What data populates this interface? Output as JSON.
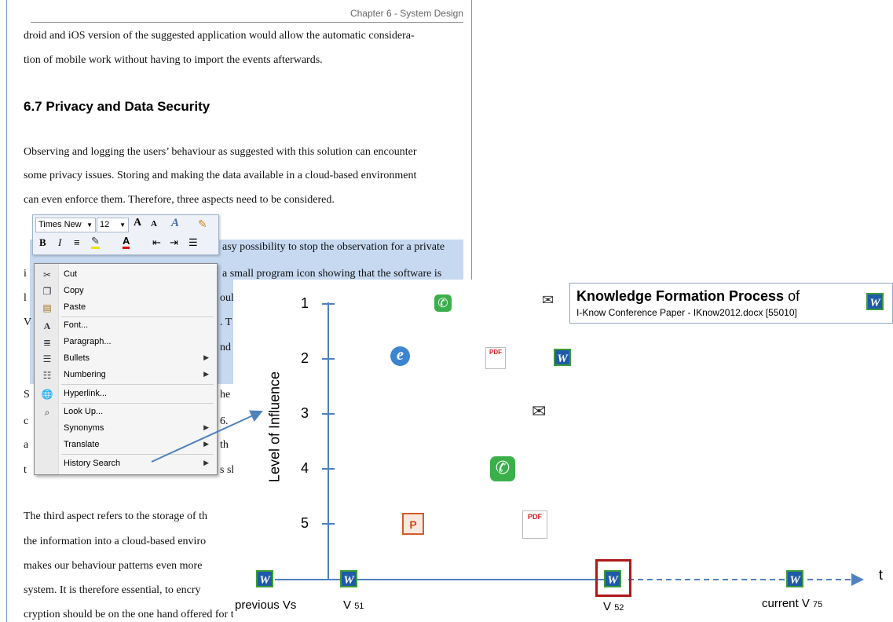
{
  "document": {
    "header": "Chapter 6 - System Design",
    "lines_top": [
      "droid and iOS version of the suggested application would allow the automatic considera-",
      "tion of mobile work without having to import the events afterwards."
    ],
    "heading": "6.7  Privacy and Data Security",
    "para1": [
      "Observing and logging the users’ behaviour as suggested with this solution can encounter",
      "some privacy issues. Storing and making the data available in a cloud-based environment",
      "can even enforce them. Therefore, three aspects need to be considered."
    ],
    "frag_easy": "asy possibility to stop the observation for a private",
    "frag_small": "a small program icon showing that the software is",
    "frag_oul": "oul",
    "frag_T": ". T",
    "frag_nd": "nd",
    "frag_he": "he a",
    "frag_6": "6.",
    "frag_th": "th",
    "frag_s": "s sl",
    "frag_S": "S",
    "frag_c": "c",
    "frag_a": "a",
    "frag_t": "t",
    "frag_i": "i",
    "frag_l": "l",
    "frag_V": "V",
    "bottom": [
      "The third aspect refers to the storage of th",
      "the information into a cloud-based enviro",
      "makes our behaviour patterns even more",
      "system. It is therefore essential, to encry",
      "cryption should be on the one hand offered for the data transfer by using an encrypted"
    ]
  },
  "mini_toolbar": {
    "font": "Times New",
    "size": "12",
    "grow_font": "A",
    "shrink_font": "A",
    "bold": "B",
    "italic": "I"
  },
  "context_menu": {
    "items": [
      {
        "label": "Cut",
        "icon": "scissors-icon"
      },
      {
        "label": "Copy",
        "icon": "copy-icon"
      },
      {
        "label": "Paste",
        "icon": "paste-icon"
      },
      {
        "label": "Font...",
        "icon": "font-icon"
      },
      {
        "label": "Paragraph...",
        "icon": "paragraph-icon"
      },
      {
        "label": "Bullets",
        "icon": "bullets-icon"
      },
      {
        "label": "Numbering",
        "icon": "numbering-icon"
      },
      {
        "label": "Hyperlink...",
        "icon": "hyperlink-icon"
      },
      {
        "label": "Look Up...",
        "icon": "lookup-icon"
      },
      {
        "label": "Synonyms"
      },
      {
        "label": "Translate"
      },
      {
        "label": "History Search"
      }
    ]
  },
  "diagram": {
    "title_bold": "Knowledge Formation Process",
    "title_rest": " of",
    "subtitle": "I-Know Conference Paper -  IKnow2012.docx [55010]",
    "y_axis_label": "Level of Influence",
    "y_ticks": [
      "1",
      "2",
      "3",
      "4",
      "5"
    ],
    "x_axis_label": "t",
    "x_labels": {
      "previous": "previous Vs",
      "v51": "V",
      "v51_sub": "51",
      "v52": "V",
      "v52_sub": "52",
      "current": "current V",
      "current_sub": "75"
    },
    "word_glyph": "W",
    "ie_glyph": "e",
    "pdf_glyph": "PDF",
    "envelope_glyph": "✉",
    "phone_glyph": "✆",
    "ppt_glyph": "P",
    "colors": {
      "axis": "#4f81bd",
      "highlight": "#b01818",
      "word": "#1f5aa8",
      "selection": "#c6d9f0"
    }
  }
}
